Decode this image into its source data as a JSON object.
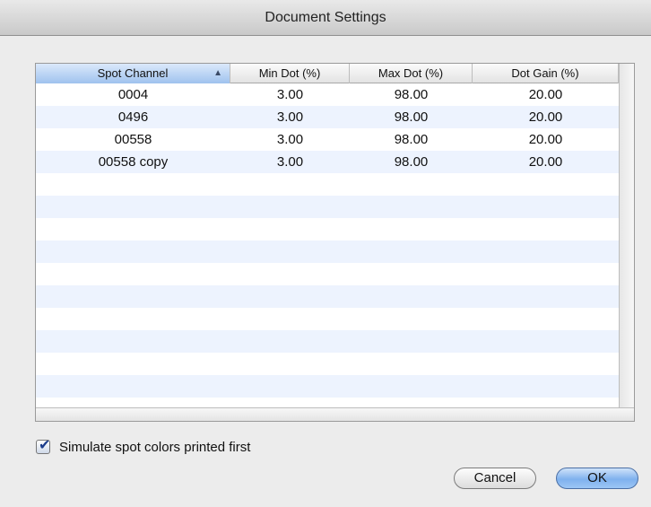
{
  "window": {
    "title": "Document Settings"
  },
  "table": {
    "columns": [
      "Spot Channel",
      "Min Dot (%)",
      "Max Dot (%)",
      "Dot Gain (%)"
    ],
    "sort_indicator": "▲",
    "rows": [
      [
        "0004",
        "3.00",
        "98.00",
        "20.00"
      ],
      [
        "0496",
        "3.00",
        "98.00",
        "20.00"
      ],
      [
        "00558",
        "3.00",
        "98.00",
        "20.00"
      ],
      [
        "00558 copy",
        "3.00",
        "98.00",
        "20.00"
      ]
    ]
  },
  "options": {
    "simulate_label": "Simulate spot colors printed first",
    "simulate_checked": true,
    "check_glyph": "✔"
  },
  "buttons": {
    "cancel_label": "Cancel",
    "ok_label": "OK"
  },
  "colors": {
    "accent": "#9fc2ee",
    "row_stripe": "#edf3fe"
  }
}
